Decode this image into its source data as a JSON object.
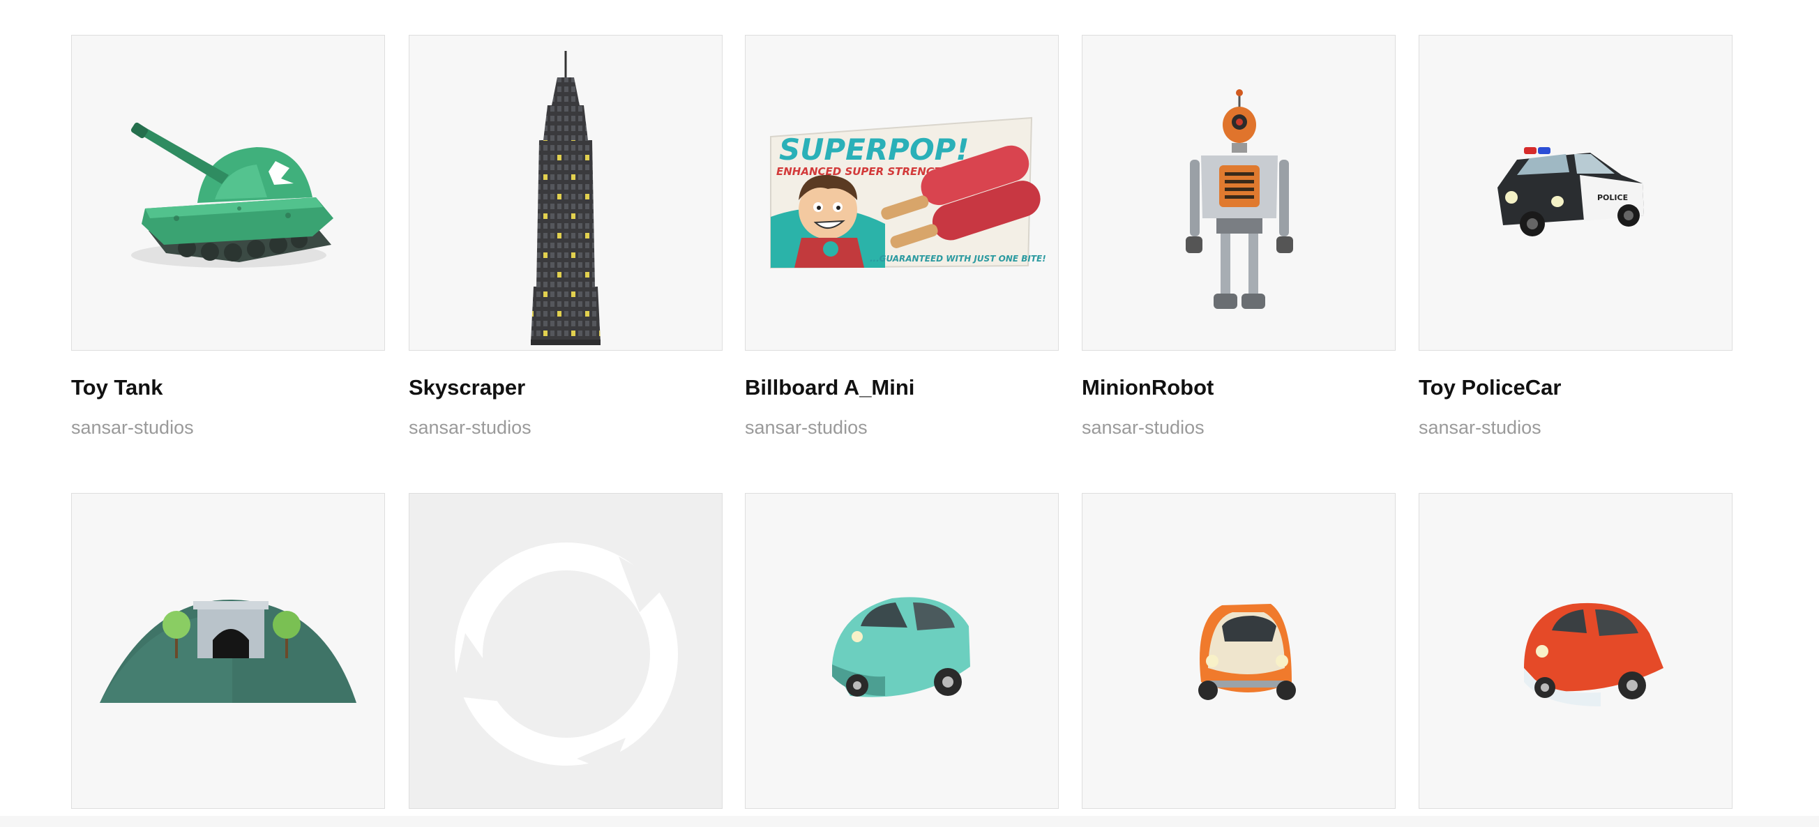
{
  "items": [
    {
      "title": "Toy Tank",
      "author": "sansar-studios",
      "icon": "toy-tank-icon"
    },
    {
      "title": "Skyscraper",
      "author": "sansar-studios",
      "icon": "skyscraper-icon"
    },
    {
      "title": "Billboard A_Mini",
      "author": "sansar-studios",
      "icon": "billboard-icon"
    },
    {
      "title": "MinionRobot",
      "author": "sansar-studios",
      "icon": "robot-icon"
    },
    {
      "title": "Toy PoliceCar",
      "author": "sansar-studios",
      "icon": "police-car-icon"
    },
    {
      "title": "",
      "author": "",
      "icon": "tunnel-hill-icon"
    },
    {
      "title": "",
      "author": "",
      "icon": "placeholder-logo-icon"
    },
    {
      "title": "",
      "author": "",
      "icon": "teal-car-icon"
    },
    {
      "title": "",
      "author": "",
      "icon": "cream-orange-car-icon"
    },
    {
      "title": "",
      "author": "",
      "icon": "red-white-car-icon"
    }
  ],
  "billboard": {
    "headline": "SUPERPOP!",
    "subline": "ENHANCED SUPER STRENGTH......",
    "tagline": "...GUARANTEED WITH JUST ONE BITE!"
  },
  "police_car": {
    "door_text": "POLICE"
  },
  "colors": {
    "title": "#111111",
    "author": "#9a9a9a",
    "thumb_bg": "#f7f7f7",
    "thumb_border": "#dedede",
    "placeholder_bg": "#efefef"
  }
}
